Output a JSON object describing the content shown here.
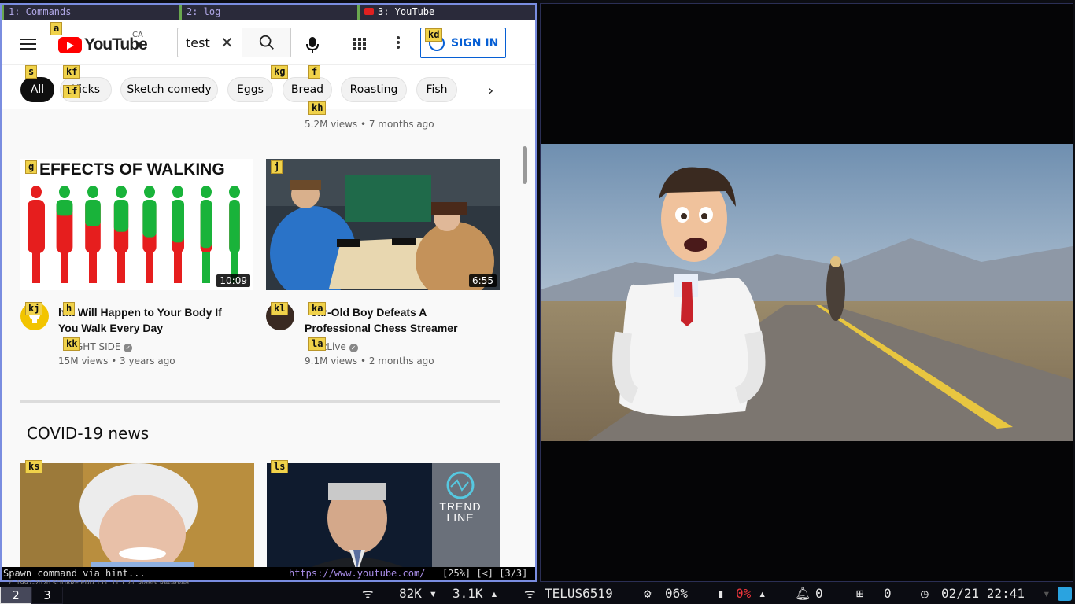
{
  "tabs": [
    "1: Commands",
    "2: log",
    "3: YouTube"
  ],
  "header": {
    "logo_text": "YouTube",
    "region": "CA",
    "search_value": "test",
    "sign_in": "SIGN IN"
  },
  "chips": [
    "All",
    "Kicks",
    "Sketch comedy",
    "Eggs",
    "Bread",
    "Roasting",
    "Fish"
  ],
  "top_partial": {
    "views": "5.2M views",
    "age": "7 months ago"
  },
  "videos": [
    {
      "title_line1": "hat Will Happen to Your Body If",
      "title_line2": "You Walk Every Day",
      "channel": "GHT SIDE",
      "views": "15M views",
      "age": "3 years ago",
      "duration": "10:09",
      "thumb_text": "EFFECTS OF WALKING"
    },
    {
      "title_line1": "ear-Old Boy Defeats A",
      "title_line2": "Professional Chess Streamer",
      "channel": "zLive",
      "views": "9.1M views",
      "age": "2 months ago",
      "duration": "6:55"
    }
  ],
  "section": {
    "title": "COVID-19 news"
  },
  "news_thumb": {
    "logo_line1": "TREND",
    "logo_line2": "LINE"
  },
  "hints": [
    "a",
    "kd",
    "s",
    "kf",
    "lf",
    "kg",
    "f",
    "kh",
    "g",
    "j",
    "kj",
    "h",
    "kk",
    "kl",
    "ka",
    "la",
    "ks",
    "ls"
  ],
  "statusline": {
    "left": "Spawn command via hint...",
    "url": "https://www.youtube.com/",
    "pos": "[25%] [<] [3/3]"
  },
  "footer_small": "© 1997-2020 SQUARE ENIX CO., LTD. All Rights Reserved.",
  "bar": {
    "ws1": "2",
    "ws2": "3",
    "down": "82K",
    "up": "3.1K",
    "ssid": "TELUS6519",
    "cpu": "06%",
    "battery": "0%",
    "notif": "0",
    "updates": "0",
    "datetime": "02/21 22:41"
  },
  "colors": {
    "accent": "#065fd4",
    "youtube_red": "#ff0000",
    "hint_bg": "#f0d24a",
    "border_focus": "#7a8de0"
  }
}
